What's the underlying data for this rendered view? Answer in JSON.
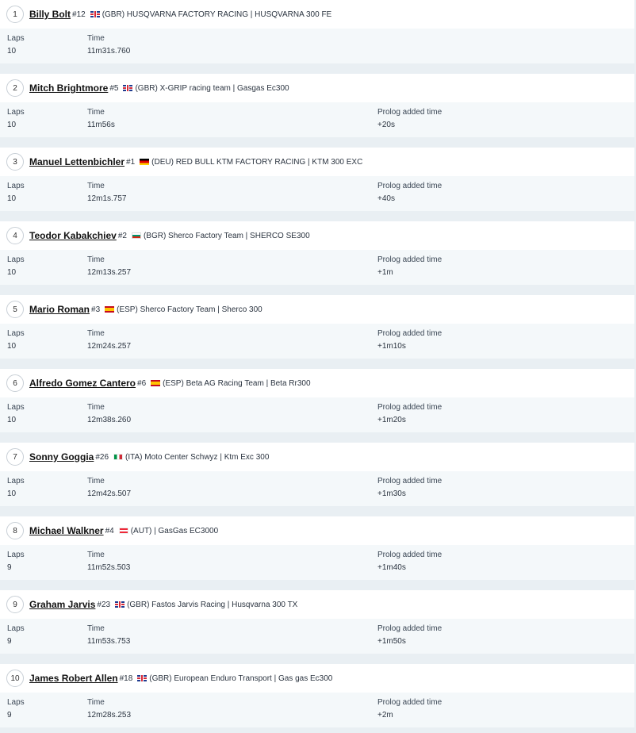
{
  "columns": {
    "laps": "Laps",
    "time": "Time",
    "prolog": "Prolog added time"
  },
  "results": [
    {
      "pos": "1",
      "name": "Billy Bolt",
      "number": "#12",
      "flag": "gbr",
      "team": "(GBR) HUSQVARNA FACTORY RACING | HUSQVARNA 300 FE",
      "laps": "10",
      "time": "11m31s.760",
      "prolog": ""
    },
    {
      "pos": "2",
      "name": "Mitch Brightmore",
      "number": "#5",
      "flag": "gbr",
      "team": "(GBR) X-GRIP racing team | Gasgas Ec300",
      "laps": "10",
      "time": "11m56s",
      "prolog": "+20s"
    },
    {
      "pos": "3",
      "name": "Manuel Lettenbichler",
      "number": "#1",
      "flag": "deu",
      "team": "(DEU) RED BULL KTM FACTORY RACING | KTM 300 EXC",
      "laps": "10",
      "time": "12m1s.757",
      "prolog": "+40s"
    },
    {
      "pos": "4",
      "name": "Teodor Kabakchiev",
      "number": "#2",
      "flag": "bgr",
      "team": "(BGR) Sherco Factory Team | SHERCO SE300",
      "laps": "10",
      "time": "12m13s.257",
      "prolog": "+1m"
    },
    {
      "pos": "5",
      "name": "Mario Roman",
      "number": "#3",
      "flag": "esp",
      "team": "(ESP) Sherco Factory Team | Sherco 300",
      "laps": "10",
      "time": "12m24s.257",
      "prolog": "+1m10s"
    },
    {
      "pos": "6",
      "name": "Alfredo Gomez Cantero",
      "number": "#6",
      "flag": "esp",
      "team": "(ESP) Beta AG Racing Team | Beta Rr300",
      "laps": "10",
      "time": "12m38s.260",
      "prolog": "+1m20s"
    },
    {
      "pos": "7",
      "name": "Sonny Goggia",
      "number": "#26",
      "flag": "ita",
      "team": "(ITA) Moto Center Schwyz | Ktm Exc 300",
      "laps": "10",
      "time": "12m42s.507",
      "prolog": "+1m30s"
    },
    {
      "pos": "8",
      "name": "Michael Walkner",
      "number": "#4",
      "flag": "aut",
      "team": "(AUT) | GasGas EC3000",
      "laps": "9",
      "time": "11m52s.503",
      "prolog": "+1m40s"
    },
    {
      "pos": "9",
      "name": "Graham Jarvis",
      "number": "#23",
      "flag": "gbr",
      "team": "(GBR) Fastos Jarvis Racing | Husqvarna 300 TX",
      "laps": "9",
      "time": "11m53s.753",
      "prolog": "+1m50s"
    },
    {
      "pos": "10",
      "name": "James Robert Allen",
      "number": "#18",
      "flag": "gbr",
      "team": "(GBR) European Enduro Transport | Gas gas Ec300",
      "laps": "9",
      "time": "12m28s.253",
      "prolog": "+2m"
    }
  ]
}
